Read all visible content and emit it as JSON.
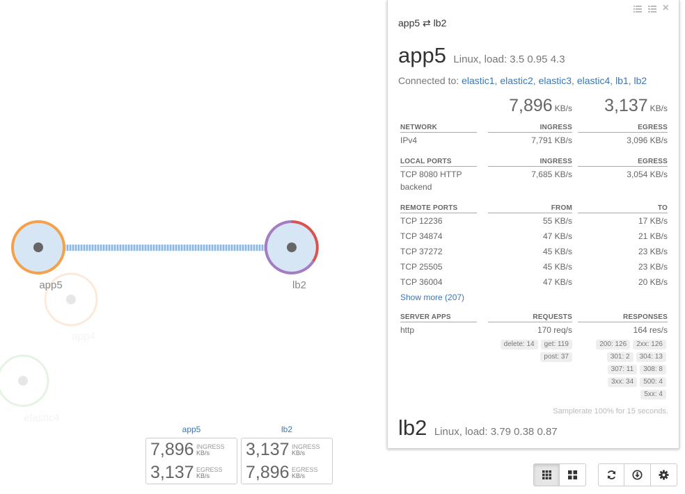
{
  "graph": {
    "nodes": [
      {
        "label": "app5"
      },
      {
        "label": "lb2"
      },
      {
        "label": "app4"
      },
      {
        "label": "elastic4"
      }
    ]
  },
  "node_stats": [
    {
      "name": "app5",
      "ingress": "7,896",
      "egress": "3,137",
      "ingress_label": "INGRESS",
      "egress_label": "EGRESS",
      "unit": "KB/s"
    },
    {
      "name": "lb2",
      "ingress": "3,137",
      "egress": "7,896",
      "ingress_label": "INGRESS",
      "egress_label": "EGRESS",
      "unit": "KB/s"
    }
  ],
  "panel": {
    "tools": {
      "icon1": "list-icon",
      "icon2": "list-icon",
      "close": "×"
    },
    "breadcrumb": {
      "from": "app5",
      "arrow": "⇄",
      "to": "lb2"
    },
    "header": {
      "title": "app5",
      "subtitle": "Linux, load: 3.5 0.95 4.3"
    },
    "connected": {
      "label": "Connected to:",
      "links": [
        "elastic1",
        "elastic2",
        "elastic3",
        "elastic4",
        "lb1",
        "lb2"
      ]
    },
    "totals": {
      "ingress": "7,896",
      "egress": "3,137",
      "unit": "KB/s"
    },
    "network": {
      "headers": [
        "NETWORK",
        "INGRESS",
        "EGRESS"
      ],
      "rows": [
        [
          "IPv4",
          "7,791 KB/s",
          "3,096 KB/s"
        ]
      ]
    },
    "local_ports": {
      "headers": [
        "LOCAL PORTS",
        "INGRESS",
        "EGRESS"
      ],
      "rows": [
        [
          "TCP 8080 HTTP backend",
          "7,685 KB/s",
          "3,054 KB/s"
        ]
      ]
    },
    "remote_ports": {
      "headers": [
        "REMOTE PORTS",
        "FROM",
        "TO"
      ],
      "rows": [
        [
          "TCP 12236",
          "55 KB/s",
          "17 KB/s"
        ],
        [
          "TCP 34874",
          "47 KB/s",
          "21 KB/s"
        ],
        [
          "TCP 37272",
          "45 KB/s",
          "23 KB/s"
        ],
        [
          "TCP 25505",
          "45 KB/s",
          "23 KB/s"
        ],
        [
          "TCP 36004",
          "47 KB/s",
          "20 KB/s"
        ]
      ]
    },
    "show_more": "Show more (207)",
    "server_apps": {
      "headers": [
        "SERVER APPS",
        "REQUESTS",
        "RESPONSES"
      ],
      "rows": [
        [
          "http",
          "170 req/s",
          "164 res/s"
        ]
      ],
      "request_tags": [
        "delete: 14",
        "get: 119",
        "post: 37"
      ],
      "response_tags": [
        "200: 126",
        "2xx: 126",
        "301: 2",
        "304: 13",
        "307: 11",
        "308: 8",
        "3xx: 34",
        "500: 4",
        "5xx: 4"
      ]
    },
    "samplerate": "Samplerate 100% for 15 seconds.",
    "footer": {
      "title": "lb2",
      "subtitle": "Linux, load: 3.79 0.38 0.87"
    }
  },
  "controls": {
    "view_buttons": [
      {
        "icon": "grid-small-icon",
        "active": true
      },
      {
        "icon": "grid-large-icon",
        "active": false
      }
    ],
    "action_buttons": [
      {
        "icon": "refresh-icon"
      },
      {
        "icon": "download-icon"
      },
      {
        "icon": "gear-icon"
      }
    ]
  },
  "colors": {
    "link": "#3a77b6",
    "node_fill": "#d6e6f5",
    "app5_ring": "#f6a04a",
    "lb2_ring_a": "#a57bc1",
    "lb2_ring_b": "#d9534f",
    "edge": "#9ec3e6"
  }
}
